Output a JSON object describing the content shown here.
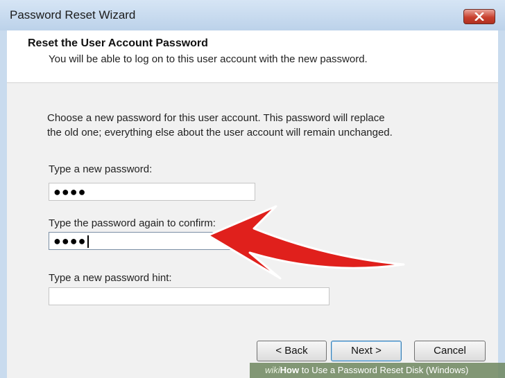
{
  "window": {
    "title": "Password Reset Wizard"
  },
  "header": {
    "title": "Reset the User Account Password",
    "subtitle": "You will be able to log on to this user account with the new password."
  },
  "body": {
    "description_line1": "Choose a new password for this user account. This password will replace",
    "description_line2": "the old one; everything else about the user account will remain unchanged.",
    "new_password_label": "Type a new password:",
    "new_password_value": "●●●●",
    "confirm_label": "Type the password again to confirm:",
    "confirm_value": "●●●●",
    "hint_label": "Type a new password hint:",
    "hint_value": ""
  },
  "buttons": {
    "back": "< Back",
    "next": "Next >",
    "cancel": "Cancel"
  },
  "watermark": {
    "brand": "wiki",
    "how": "How",
    "text": " to Use a Password Reset Disk (Windows)"
  },
  "colors": {
    "arrow": "#e0201c",
    "titlebar": "#c9dbee",
    "close": "#c8412f"
  }
}
